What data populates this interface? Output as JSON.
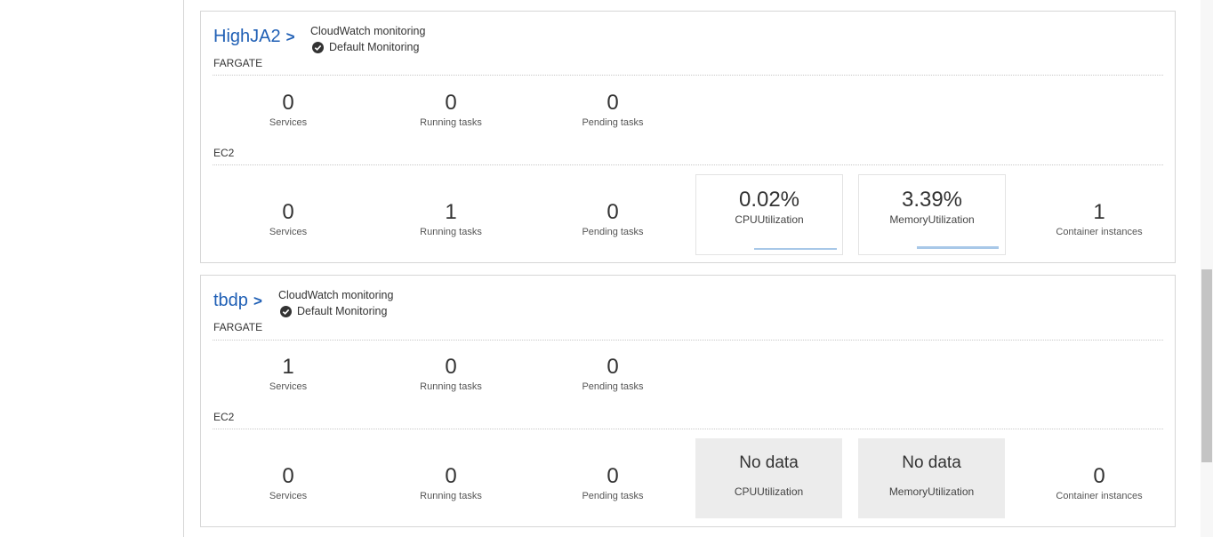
{
  "clusters": [
    {
      "name": "HighJA2",
      "chevron": ">",
      "cloudwatch_label": "CloudWatch monitoring",
      "monitoring_status": "Default Monitoring",
      "fargate": {
        "label": "FARGATE",
        "services": "0",
        "services_label": "Services",
        "running": "0",
        "running_label": "Running tasks",
        "pending": "0",
        "pending_label": "Pending tasks"
      },
      "ec2": {
        "label": "EC2",
        "services": "0",
        "services_label": "Services",
        "running": "1",
        "running_label": "Running tasks",
        "pending": "0",
        "pending_label": "Pending tasks",
        "cpu_value": "0.02%",
        "cpu_label": "CPUUtilization",
        "mem_value": "3.39%",
        "mem_label": "MemoryUtilization",
        "instances": "1",
        "instances_label": "Container instances"
      }
    },
    {
      "name": "tbdp",
      "chevron": ">",
      "cloudwatch_label": "CloudWatch monitoring",
      "monitoring_status": "Default Monitoring",
      "fargate": {
        "label": "FARGATE",
        "services": "1",
        "services_label": "Services",
        "running": "0",
        "running_label": "Running tasks",
        "pending": "0",
        "pending_label": "Pending tasks"
      },
      "ec2": {
        "label": "EC2",
        "services": "0",
        "services_label": "Services",
        "running": "0",
        "running_label": "Running tasks",
        "pending": "0",
        "pending_label": "Pending tasks",
        "cpu_value": "No data",
        "cpu_label": "CPUUtilization",
        "mem_value": "No data",
        "mem_label": "MemoryUtilization",
        "instances": "0",
        "instances_label": "Container instances"
      }
    }
  ],
  "colors": {
    "link": "#1f5fb5",
    "sparkline": "#a8c8e8",
    "nodata_bg": "#ececec"
  }
}
